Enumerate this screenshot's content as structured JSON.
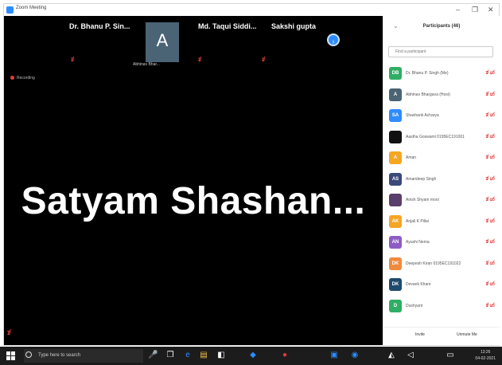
{
  "window": {
    "title": "Zoom Meeting",
    "minimize": "–",
    "restore": "❐",
    "close": "✕"
  },
  "strip": {
    "tiles": [
      {
        "name": "Dr. Bhanu P. Sin..."
      },
      {
        "name": "Md. Taqui Siddi..."
      },
      {
        "name": "Sakshi gupta"
      }
    ],
    "avatar_letter": "A",
    "avatar_name": "Abhinav Bhar...",
    "next": "›"
  },
  "recording": "Recording",
  "speaker_name": "Satyam Shashan...",
  "panel": {
    "title": "Participants (46)",
    "search_placeholder": "Find a participant",
    "participants": [
      {
        "initials": "DB",
        "name": "Dr. Bhanu P. Singh (Me)",
        "color": "#2fae64"
      },
      {
        "initials": "A",
        "name": "Abhinav Bhargava (Host)",
        "color": "#4a6475"
      },
      {
        "initials": "SA",
        "name": "Shashank Acharya",
        "color": "#2d8cff"
      },
      {
        "initials": "",
        "name": "Aastha Goswami 0195EC191001",
        "color": "#111111"
      },
      {
        "initials": "A",
        "name": "Aman",
        "color": "#f5a623"
      },
      {
        "initials": "AS",
        "name": "Amandeep Singh",
        "color": "#3a4a7a"
      },
      {
        "initials": "",
        "name": "Anish Shyam mool",
        "color": "#5a3e6b"
      },
      {
        "initials": "AK",
        "name": "Anjali K Pillai",
        "color": "#f5a623"
      },
      {
        "initials": "AN",
        "name": "Ayushi Nema",
        "color": "#8e5cc4"
      },
      {
        "initials": "DK",
        "name": "Deepesh Kiran 0195EC191022",
        "color": "#f08a3c"
      },
      {
        "initials": "DK",
        "name": "Devank Khare",
        "color": "#1f4a6e"
      },
      {
        "initials": "D",
        "name": "Dushyant",
        "color": "#2fae64"
      }
    ],
    "invite": "Invite",
    "mute_me": "Unmute Me"
  },
  "taskbar": {
    "search_placeholder": "Type here to search",
    "time": "13:26",
    "date": "04-02-2021"
  }
}
